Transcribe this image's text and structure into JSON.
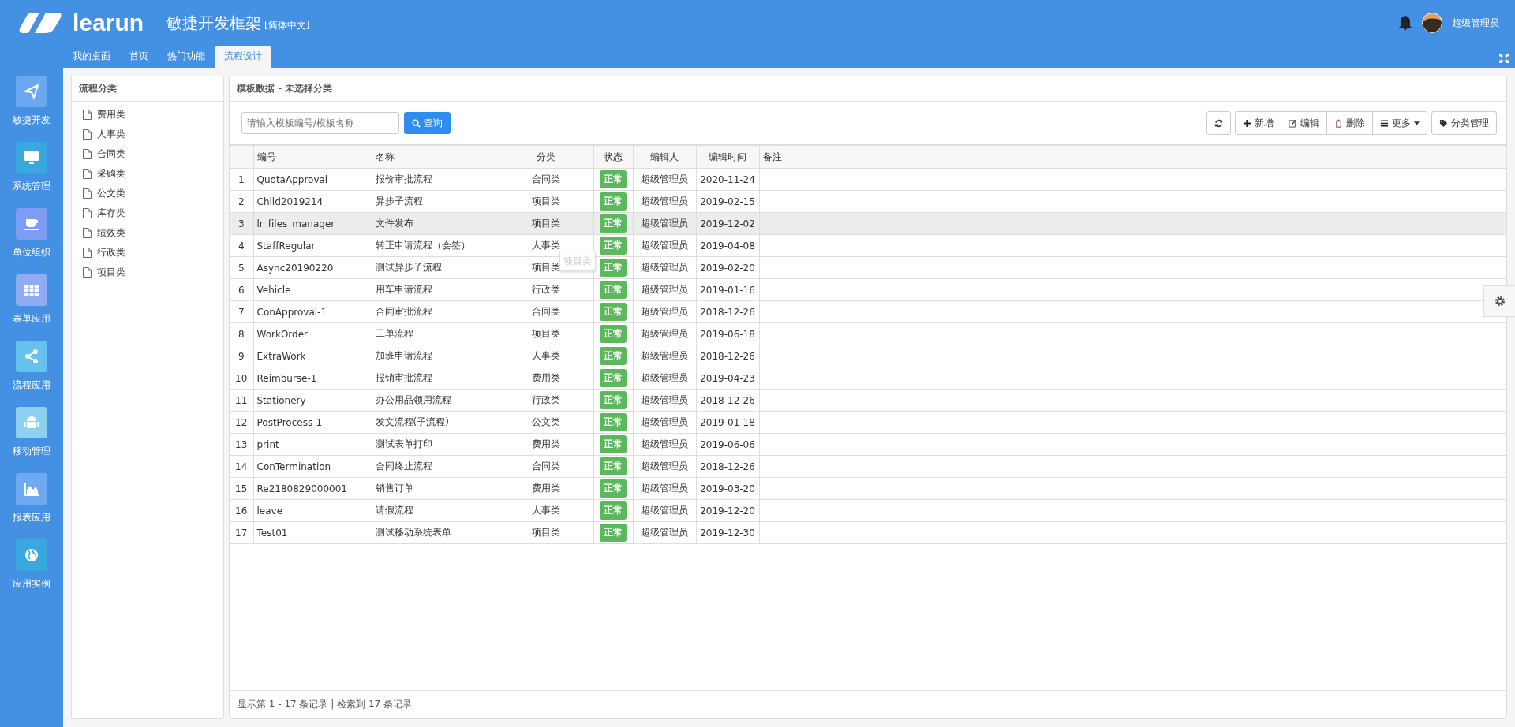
{
  "header": {
    "logo": "learun",
    "title": "敏捷开发框架",
    "language": "[简体中文]",
    "user": "超级管理员"
  },
  "tabs": [
    {
      "label": "我的桌面",
      "selected": false
    },
    {
      "label": "首页",
      "selected": false
    },
    {
      "label": "热门功能",
      "selected": false
    },
    {
      "label": "流程设计",
      "selected": true
    }
  ],
  "sidebar": {
    "items": [
      {
        "label": "敏捷开发",
        "kind": "send",
        "color": "#6aa9f2"
      },
      {
        "label": "系统管理",
        "kind": "monitor",
        "color": "#39a7e0"
      },
      {
        "label": "单位组织",
        "kind": "cup",
        "color": "#7d9cf3"
      },
      {
        "label": "表单应用",
        "kind": "table",
        "color": "#8fabf2"
      },
      {
        "label": "流程应用",
        "kind": "share",
        "color": "#66c1ef"
      },
      {
        "label": "移动管理",
        "kind": "android",
        "color": "#8fcff0"
      },
      {
        "label": "报表应用",
        "kind": "chart",
        "color": "#6fa9ef"
      },
      {
        "label": "应用实例",
        "kind": "globe",
        "color": "#39a7e0"
      }
    ]
  },
  "tree": {
    "title": "流程分类",
    "items": [
      "费用类",
      "人事类",
      "合同类",
      "采购类",
      "公文类",
      "库存类",
      "绩效类",
      "行政类",
      "项目类"
    ]
  },
  "main": {
    "title": "模板数据 - 未选择分类",
    "search": {
      "placeholder": "请输入模板编号/模板名称",
      "button": "查询"
    },
    "toolbar": [
      {
        "kind": "refresh"
      },
      {
        "kind": "add",
        "label": "新增"
      },
      {
        "kind": "edit",
        "label": "编辑"
      },
      {
        "kind": "delete",
        "label": "删除"
      },
      {
        "kind": "more",
        "label": "更多"
      },
      {
        "kind": "tag",
        "label": "分类管理"
      }
    ],
    "table": {
      "columns": [
        "编号",
        "名称",
        "分类",
        "状态",
        "编辑人",
        "编辑时间",
        "备注"
      ],
      "rows": [
        {
          "index": "1",
          "code": "QuotaApproval",
          "name": "报价审批流程",
          "category": "合同类",
          "status": "正常",
          "editor": "超级管理员",
          "time": "2020-11-24",
          "selected": false
        },
        {
          "index": "2",
          "code": "Child2019214",
          "name": "异步子流程",
          "category": "项目类",
          "status": "正常",
          "editor": "超级管理员",
          "time": "2019-02-15",
          "selected": false
        },
        {
          "index": "3",
          "code": "lr_files_manager",
          "name": "文件发布",
          "category": "项目类",
          "status": "正常",
          "editor": "超级管理员",
          "time": "2019-12-02",
          "selected": true
        },
        {
          "index": "4",
          "code": "StaffRegular",
          "name": "转正申请流程（会签）",
          "category": "人事类",
          "status": "正常",
          "editor": "超级管理员",
          "time": "2019-04-08",
          "selected": false
        },
        {
          "index": "5",
          "code": "Async20190220",
          "name": "测试异步子流程",
          "category": "项目类",
          "status": "正常",
          "editor": "超级管理员",
          "time": "2019-02-20",
          "selected": false
        },
        {
          "index": "6",
          "code": "Vehicle",
          "name": "用车申请流程",
          "category": "行政类",
          "status": "正常",
          "editor": "超级管理员",
          "time": "2019-01-16",
          "selected": false
        },
        {
          "index": "7",
          "code": "ConApproval-1",
          "name": "合同审批流程",
          "category": "合同类",
          "status": "正常",
          "editor": "超级管理员",
          "time": "2018-12-26",
          "selected": false
        },
        {
          "index": "8",
          "code": "WorkOrder",
          "name": "工单流程",
          "category": "项目类",
          "status": "正常",
          "editor": "超级管理员",
          "time": "2019-06-18",
          "selected": false
        },
        {
          "index": "9",
          "code": "ExtraWork",
          "name": "加班申请流程",
          "category": "人事类",
          "status": "正常",
          "editor": "超级管理员",
          "time": "2018-12-26",
          "selected": false
        },
        {
          "index": "10",
          "code": "Reimburse-1",
          "name": "报销审批流程",
          "category": "费用类",
          "status": "正常",
          "editor": "超级管理员",
          "time": "2019-04-23",
          "selected": false
        },
        {
          "index": "11",
          "code": "Stationery",
          "name": "办公用品领用流程",
          "category": "行政类",
          "status": "正常",
          "editor": "超级管理员",
          "time": "2018-12-26",
          "selected": false
        },
        {
          "index": "12",
          "code": "PostProcess-1",
          "name": "发文流程(子流程)",
          "category": "公文类",
          "status": "正常",
          "editor": "超级管理员",
          "time": "2019-01-18",
          "selected": false
        },
        {
          "index": "13",
          "code": "print",
          "name": "测试表单打印",
          "category": "费用类",
          "status": "正常",
          "editor": "超级管理员",
          "time": "2019-06-06",
          "selected": false
        },
        {
          "index": "14",
          "code": "ConTermination",
          "name": "合同终止流程",
          "category": "合同类",
          "status": "正常",
          "editor": "超级管理员",
          "time": "2018-12-26",
          "selected": false
        },
        {
          "index": "15",
          "code": "Re2180829000001",
          "name": "销售订单",
          "category": "费用类",
          "status": "正常",
          "editor": "超级管理员",
          "time": "2019-03-20",
          "selected": false
        },
        {
          "index": "16",
          "code": "leave",
          "name": "请假流程",
          "category": "人事类",
          "status": "正常",
          "editor": "超级管理员",
          "time": "2019-12-20",
          "selected": false
        },
        {
          "index": "17",
          "code": "Test01",
          "name": "测试移动系统表单",
          "category": "项目类",
          "status": "正常",
          "editor": "超级管理员",
          "time": "2019-12-30",
          "selected": false
        }
      ]
    },
    "tooltip": "项目类",
    "footer": "显示第 1 - 17 条记录 | 检索到 17 条记录"
  }
}
